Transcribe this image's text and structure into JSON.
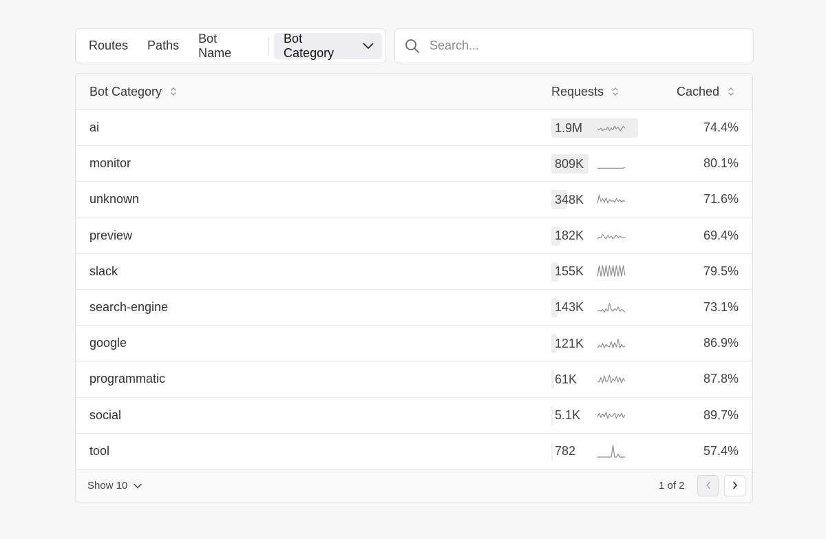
{
  "toolbar": {
    "tabs": [
      {
        "label": "Routes"
      },
      {
        "label": "Paths"
      },
      {
        "label": "Bot Name"
      },
      {
        "label": "Bot Category"
      }
    ],
    "search_placeholder": "Search..."
  },
  "table": {
    "headers": {
      "name": "Bot Category",
      "requests": "Requests",
      "cached": "Cached"
    },
    "rows": [
      {
        "name": "ai",
        "requests": "1.9M",
        "share": 1.0,
        "cached": "74.4%",
        "spark": [
          6,
          5,
          7,
          4,
          6,
          5,
          8,
          4,
          7,
          5,
          9,
          6,
          8,
          4,
          6,
          9,
          7
        ]
      },
      {
        "name": "monitor",
        "requests": "809K",
        "share": 0.43,
        "cached": "80.1%",
        "spark": [
          2,
          2,
          2,
          2,
          2,
          2,
          2,
          2,
          2,
          2,
          2,
          2,
          2,
          2,
          2,
          2,
          3
        ]
      },
      {
        "name": "unknown",
        "requests": "348K",
        "share": 0.18,
        "cached": "71.6%",
        "spark": [
          3,
          12,
          5,
          8,
          4,
          9,
          3,
          7,
          5,
          6,
          4,
          8,
          5,
          7,
          4,
          6,
          5
        ]
      },
      {
        "name": "preview",
        "requests": "182K",
        "share": 0.1,
        "cached": "69.4%",
        "spark": [
          4,
          6,
          5,
          9,
          6,
          4,
          8,
          5,
          7,
          4,
          6,
          8,
          5,
          7,
          6,
          5,
          6
        ]
      },
      {
        "name": "slack",
        "requests": "155K",
        "share": 0.08,
        "cached": "79.5%",
        "spark": [
          2,
          14,
          2,
          14,
          2,
          14,
          2,
          14,
          3,
          14,
          2,
          14,
          2,
          14,
          2,
          14,
          3
        ]
      },
      {
        "name": "search-engine",
        "requests": "143K",
        "share": 0.075,
        "cached": "73.1%",
        "spark": [
          3,
          4,
          3,
          5,
          2,
          6,
          3,
          12,
          5,
          3,
          6,
          4,
          8,
          3,
          5,
          4,
          2
        ]
      },
      {
        "name": "google",
        "requests": "121K",
        "share": 0.064,
        "cached": "86.9%",
        "spark": [
          2,
          5,
          3,
          7,
          2,
          6,
          4,
          3,
          9,
          2,
          8,
          3,
          12,
          2,
          6,
          3,
          4
        ]
      },
      {
        "name": "programmatic",
        "requests": "61K",
        "share": 0.032,
        "cached": "87.8%",
        "spark": [
          5,
          4,
          9,
          3,
          11,
          4,
          6,
          12,
          3,
          8,
          5,
          10,
          4,
          9,
          3,
          8,
          5
        ]
      },
      {
        "name": "social",
        "requests": "5.1K",
        "share": 0.003,
        "cached": "89.7%",
        "spark": [
          6,
          10,
          5,
          9,
          6,
          11,
          4,
          9,
          6,
          7,
          10,
          4,
          9,
          6,
          10,
          5,
          8
        ]
      },
      {
        "name": "tool",
        "requests": "782",
        "share": 0.001,
        "cached": "57.4%",
        "spark": [
          1,
          1,
          1,
          1,
          1,
          1,
          1,
          1,
          1,
          18,
          1,
          1,
          5,
          1,
          1,
          1,
          1
        ]
      }
    ]
  },
  "footer": {
    "show_label": "Show 10",
    "page_info": "1 of 2"
  },
  "colors": {
    "spark": "#8e8e93",
    "bar": "#eeeeef",
    "active_tab": "#eeeeef"
  }
}
